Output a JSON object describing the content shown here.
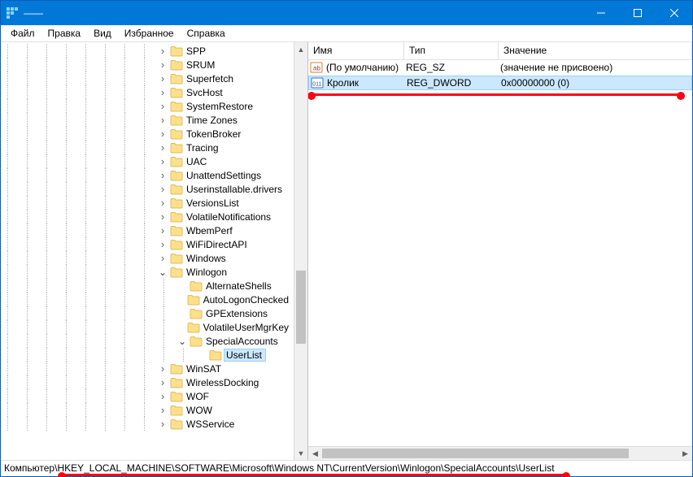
{
  "titlebar": {
    "title": "——"
  },
  "menu": {
    "file": "Файл",
    "edit": "Правка",
    "view": "Вид",
    "fav": "Избранное",
    "help": "Справка"
  },
  "tree": {
    "items": [
      "SPP",
      "SRUM",
      "Superfetch",
      "SvcHost",
      "SystemRestore",
      "Time Zones",
      "TokenBroker",
      "Tracing",
      "UAC",
      "UnattendSettings",
      "Userinstallable.drivers",
      "VersionsList",
      "VolatileNotifications",
      "WbemPerf",
      "WiFiDirectAPI",
      "Windows",
      "Winlogon"
    ],
    "winlogon_children": [
      "AlternateShells",
      "AutoLogonChecked",
      "GPExtensions",
      "VolatileUserMgrKey",
      "SpecialAccounts"
    ],
    "userlist": "UserList",
    "tail": [
      "WinSAT",
      "WirelessDocking",
      "WOF",
      "WOW",
      "WSService"
    ]
  },
  "list": {
    "headers": {
      "name": "Имя",
      "type": "Тип",
      "value": "Значение"
    },
    "rows": [
      {
        "name": "(По умолчанию)",
        "type": "REG_SZ",
        "value": "(значение не присвоено)",
        "kind": "sz"
      },
      {
        "name": "Кролик",
        "type": "REG_DWORD",
        "value": "0x00000000 (0)",
        "kind": "bin",
        "selected": true
      }
    ]
  },
  "status": {
    "path": "Компьютер\\HKEY_LOCAL_MACHINE\\SOFTWARE\\Microsoft\\Windows NT\\CurrentVersion\\Winlogon\\SpecialAccounts\\UserList"
  }
}
